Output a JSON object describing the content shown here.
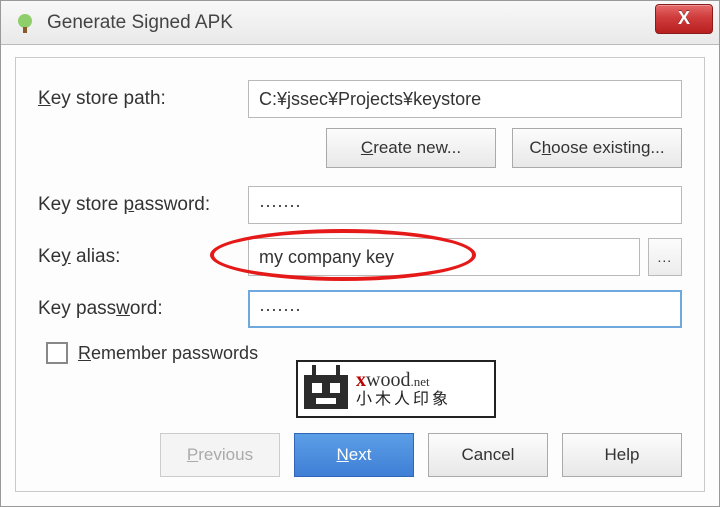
{
  "window": {
    "title": "Generate Signed APK",
    "close": "X"
  },
  "labels": {
    "keystore_path_pre": "K",
    "keystore_path_rest": "ey store path:",
    "create_pre": "C",
    "create_rest": "reate new...",
    "choose_pre": "C",
    "choose_mid": "h",
    "choose_rest": "oose existing...",
    "kspw_pre": "Key store ",
    "kspw_u": "p",
    "kspw_rest": "assword:",
    "alias_pre": "Ke",
    "alias_u": "y",
    "alias_rest": " alias:",
    "keypw_pre": "Key pass",
    "keypw_u": "w",
    "keypw_rest": "ord:",
    "remember_u": "R",
    "remember_rest": "emember passwords",
    "ellipsis": "..."
  },
  "values": {
    "keystore_path": "C:¥jssec¥Projects¥keystore",
    "ks_password": "·······",
    "key_alias": "my company key",
    "key_password": "·······"
  },
  "logo": {
    "brand_plain_pre": "",
    "brand_x": "x",
    "brand_rest": "wood",
    "brand_tld": ".net",
    "tagline": "小木人印象"
  },
  "buttons": {
    "previous_u": "P",
    "previous_rest": "revious",
    "next_u": "N",
    "next_rest": "ext",
    "cancel": "Cancel",
    "help": "Help"
  }
}
